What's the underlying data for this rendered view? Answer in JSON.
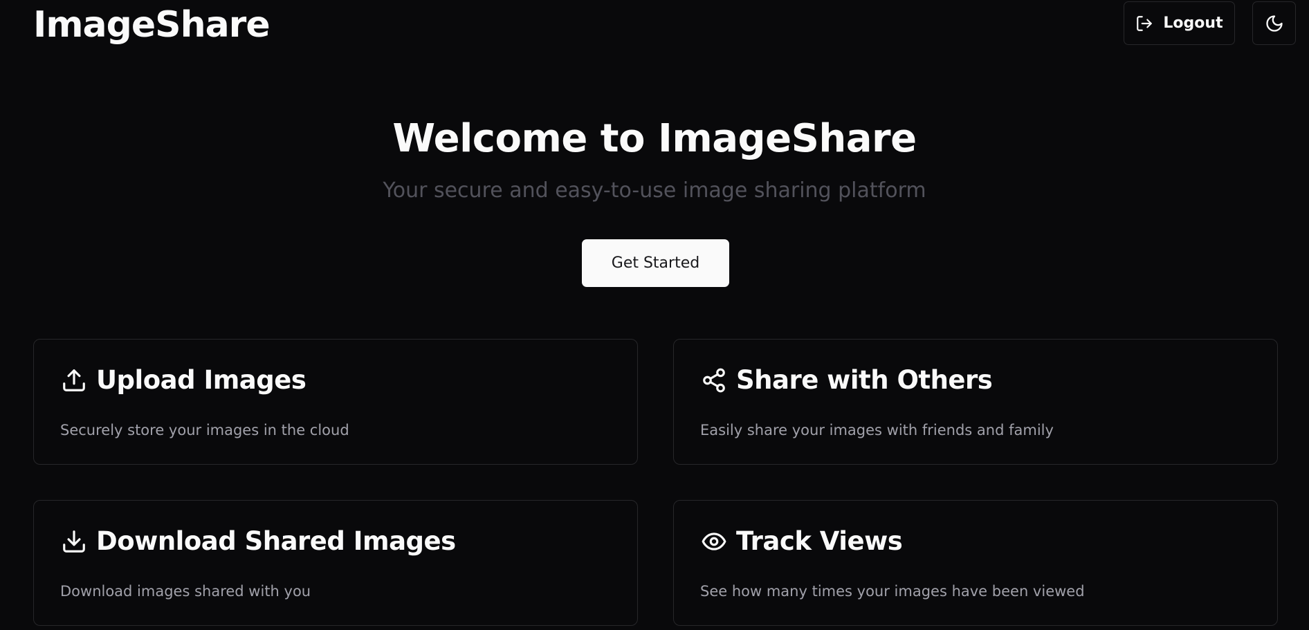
{
  "header": {
    "brand": "ImageShare",
    "logout_label": "Logout",
    "logout_icon": "log-out-icon",
    "theme_icon": "moon-icon"
  },
  "hero": {
    "title": "Welcome to ImageShare",
    "subtitle": "Your secure and easy-to-use image sharing platform",
    "cta_label": "Get Started"
  },
  "features": [
    {
      "title": "Upload Images",
      "description": "Securely store your images in the cloud",
      "icon": "upload-icon"
    },
    {
      "title": "Share with Others",
      "description": "Easily share your images with friends and family",
      "icon": "share-icon"
    },
    {
      "title": "Download Shared Images",
      "description": "Download images shared with you",
      "icon": "download-icon"
    },
    {
      "title": "Track Views",
      "description": "See how many times your images have been viewed",
      "icon": "eye-icon"
    }
  ],
  "colors": {
    "background": "#09090b",
    "border": "#27272a",
    "foreground": "#fafafa",
    "muted": "#a1a1aa",
    "subtitle": "#52525b"
  }
}
